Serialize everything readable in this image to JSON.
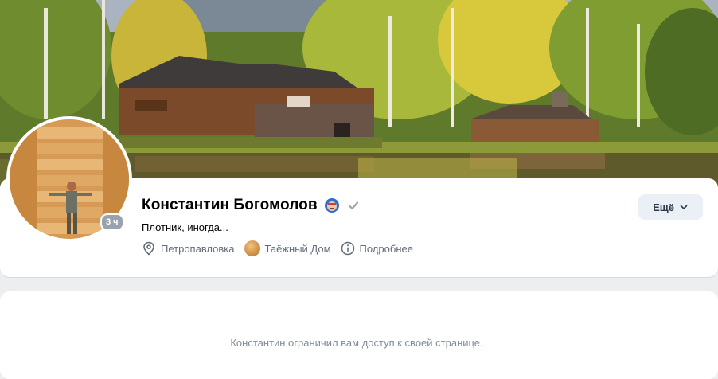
{
  "profile": {
    "name": "Константин Богомолов",
    "status": "Плотник, иногда...",
    "online": "3 ч",
    "info": {
      "city": "Петропавловка",
      "group": "Таёжный Дом",
      "details": "Подробнее"
    },
    "more_label": "Ещё"
  },
  "restricted": {
    "message": "Константин ограничил вам доступ к своей странице."
  },
  "icons": {
    "place": "location-pin-icon",
    "info": "info-circle-icon",
    "verified": "checkmark-icon",
    "chevron": "chevron-down-icon"
  },
  "colors": {
    "page_bg": "#edeef0",
    "card_bg": "#ffffff",
    "secondary_text": "#626d7a",
    "muted_text": "#818c99",
    "button_bg": "#ebf0f7"
  }
}
